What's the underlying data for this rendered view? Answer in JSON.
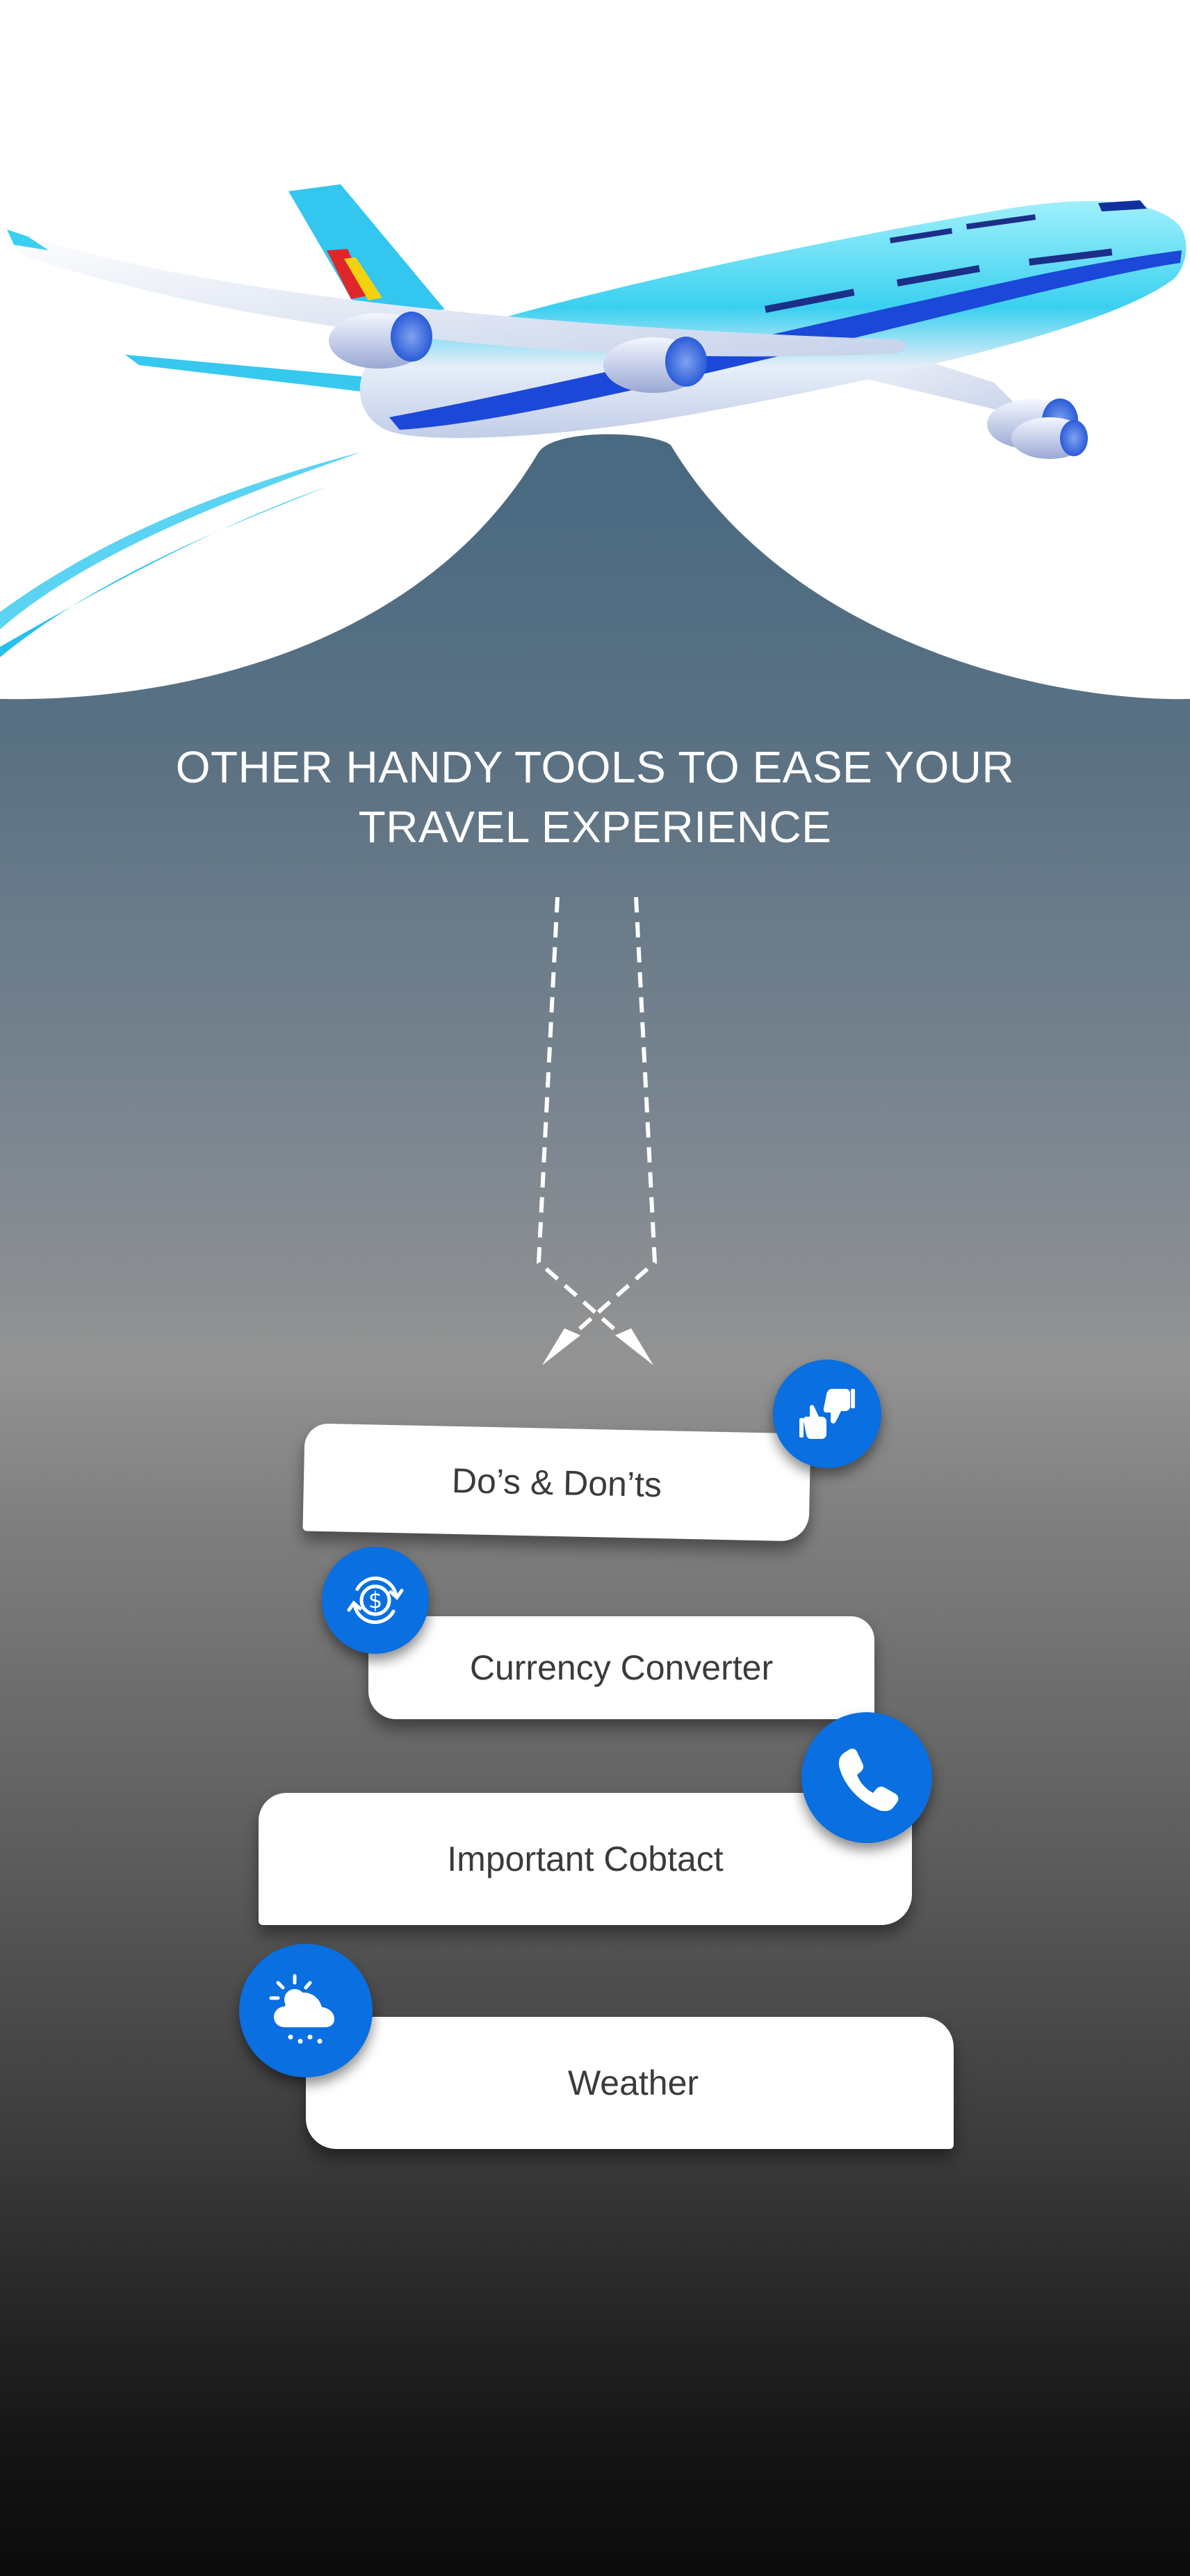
{
  "headline": {
    "line1": "OTHER HANDY TOOLS TO EASE YOUR",
    "line2": "TRAVEL EXPERIENCE"
  },
  "hero": {
    "illustration_icon": "airplane-icon"
  },
  "tools": [
    {
      "label": "Do’s & Don’ts",
      "icon": "thumbs-up-down-icon"
    },
    {
      "label": "Currency Converter",
      "icon": "currency-exchange-icon"
    },
    {
      "label": "Important Cobtact",
      "icon": "phone-icon"
    },
    {
      "label": "Weather",
      "icon": "weather-icon"
    }
  ],
  "colors": {
    "accent": "#0a6fe0",
    "card": "#ffffff",
    "text": "#3b3b3b",
    "headline": "#ffffff"
  }
}
